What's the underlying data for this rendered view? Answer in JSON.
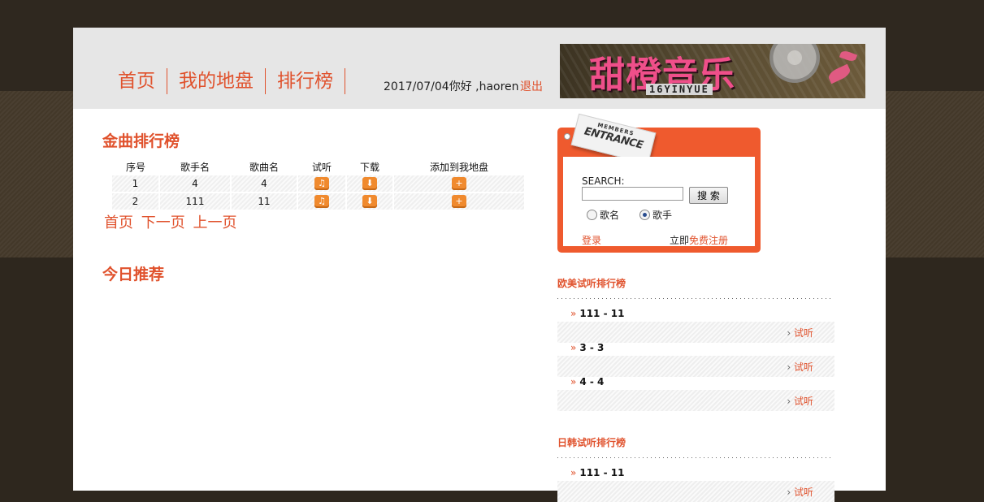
{
  "nav": {
    "items": [
      "首页",
      "我的地盘",
      "排行榜"
    ],
    "user_info": "2017/07/04你好 ,haoren",
    "logout": "退出"
  },
  "banner": {
    "title": "甜橙音乐",
    "subtitle": "16YINYUE"
  },
  "main": {
    "gold_title": "金曲排行榜",
    "columns": [
      "序号",
      "歌手名",
      "歌曲名",
      "试听",
      "下载",
      "添加到我地盘"
    ],
    "rows": [
      {
        "no": "1",
        "singer": "4",
        "song": "4"
      },
      {
        "no": "2",
        "singer": "111",
        "song": "11"
      }
    ],
    "pager": {
      "first": "首页",
      "next": "下一页",
      "prev": "上一页"
    },
    "today_title": "今日推荐"
  },
  "login": {
    "tag_small": "MEMBERS",
    "tag_big": "ENTRANCE",
    "search_label": "SEARCH:",
    "search_value": "",
    "search_button": "搜 索",
    "radio_song": "歌名",
    "radio_singer": "歌手",
    "selected": "歌手",
    "login_link": "登录",
    "register_prefix": "立即",
    "register_link": "免费注册"
  },
  "western": {
    "title": "欧美试听排行榜",
    "items": [
      {
        "text": "111 - 11",
        "action": "试听"
      },
      {
        "text": "3 - 3",
        "action": "试听"
      },
      {
        "text": "4 - 4",
        "action": "试听"
      }
    ]
  },
  "jpkr": {
    "title": "日韩试听排行榜",
    "items": [
      {
        "text": "111 - 11",
        "action": "试听"
      }
    ]
  },
  "colors": {
    "accent": "#e0522d",
    "login_box": "#ef5a2e",
    "icon_orange": "#f08a2e"
  },
  "icons": {
    "listen": "headphones-icon",
    "download": "download-icon",
    "add": "plus-icon"
  }
}
